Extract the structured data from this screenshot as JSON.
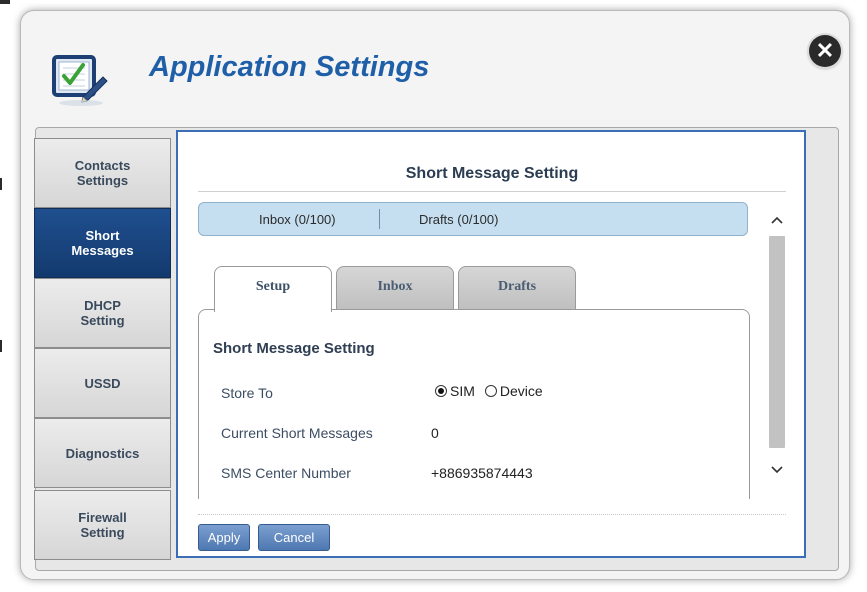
{
  "dialog": {
    "title": "Application Settings",
    "icon": "checklist-pencil-icon",
    "close_icon": "close-x-icon"
  },
  "sidebar": {
    "items": [
      {
        "label": "Contacts Settings",
        "active": false
      },
      {
        "label": "Short Messages",
        "active": true
      },
      {
        "label": "DHCP Setting",
        "active": false
      },
      {
        "label": "USSD",
        "active": false
      },
      {
        "label": "Diagnostics",
        "active": false
      },
      {
        "label": "Firewall Setting",
        "active": false
      }
    ]
  },
  "content": {
    "title": "Short Message Setting",
    "counts": {
      "inbox": "Inbox (0/100)",
      "drafts": "Drafts (0/100)"
    },
    "tabs": [
      {
        "label": "Setup",
        "active": true
      },
      {
        "label": "Inbox",
        "active": false
      },
      {
        "label": "Drafts",
        "active": false
      }
    ],
    "panel": {
      "title": "Short Message Setting",
      "store_to": {
        "label": "Store To",
        "options": [
          "SIM",
          "Device"
        ],
        "selected": "SIM"
      },
      "current_messages": {
        "label": "Current Short Messages",
        "value": "0"
      },
      "sms_center": {
        "label": "SMS Center Number",
        "value": "+886935874443"
      }
    },
    "buttons": {
      "apply": "Apply",
      "cancel": "Cancel"
    }
  },
  "colors": {
    "title_blue": "#1f5fa8",
    "active_nav": "#1a4680",
    "content_border": "#3a6fb5",
    "counts_bar": "#c5dff0",
    "button": "#5a82bb"
  }
}
